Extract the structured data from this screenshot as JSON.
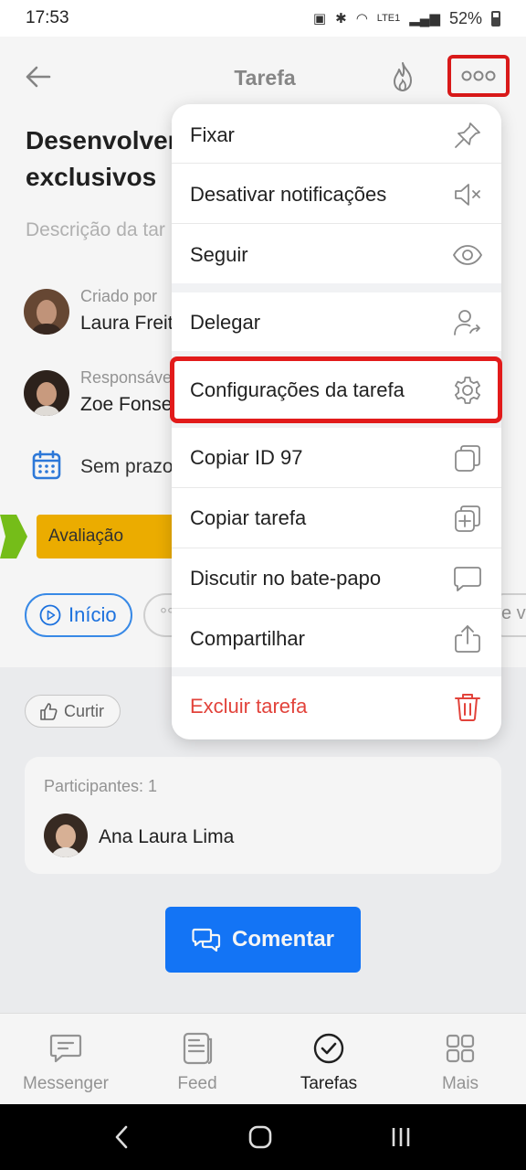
{
  "status_bar": {
    "time": "17:53",
    "battery": "52%",
    "network": "LTE1"
  },
  "header": {
    "title": "Tarefa"
  },
  "task": {
    "title_line1": "Desenvolver",
    "title_line2": "exclusivos",
    "description_placeholder": "Descrição da tar"
  },
  "created_by": {
    "role": "Criado por",
    "name": "Laura Freit"
  },
  "assignee": {
    "role": "Responsáve",
    "name": "Zoe Fonse"
  },
  "deadline": {
    "text": "Sem prazo"
  },
  "stage": {
    "label": "Avaliação",
    "color": "#f5b400",
    "prev_color": "#7ac51b"
  },
  "actions": {
    "start_label": "Início",
    "ghost_label": "°°",
    "edge_label": "e ve"
  },
  "like": {
    "label": "Curtir"
  },
  "participants": {
    "label": "Participantes: 1",
    "list": [
      {
        "name": "Ana Laura Lima"
      }
    ]
  },
  "comment_button": {
    "label": "Comentar"
  },
  "bottom_nav": {
    "items": [
      {
        "label": "Messenger",
        "icon": "chat-icon"
      },
      {
        "label": "Feed",
        "icon": "feed-icon"
      },
      {
        "label": "Tarefas",
        "icon": "check-circle-icon",
        "active": true
      },
      {
        "label": "Mais",
        "icon": "grid-icon"
      }
    ]
  },
  "menu": {
    "items": [
      {
        "label": "Fixar",
        "icon": "pin-icon"
      },
      {
        "label": "Desativar notificações",
        "icon": "mute-icon"
      },
      {
        "label": "Seguir",
        "icon": "eye-icon"
      },
      {
        "label": "Delegar",
        "icon": "delegate-icon"
      },
      {
        "label": "Configurações da tarefa",
        "icon": "gear-icon",
        "highlighted": true
      },
      {
        "label": "Copiar ID 97",
        "icon": "copy-icon"
      },
      {
        "label": "Copiar tarefa",
        "icon": "copy-plus-icon"
      },
      {
        "label": "Discutir no bate-papo",
        "icon": "chat-bubble-icon"
      },
      {
        "label": "Compartilhar",
        "icon": "share-icon"
      },
      {
        "label": "Excluir tarefa",
        "icon": "trash-icon",
        "danger": true
      }
    ]
  },
  "colors": {
    "accent": "#1479ff",
    "highlight": "#e21b1b",
    "danger": "#e2433b"
  }
}
